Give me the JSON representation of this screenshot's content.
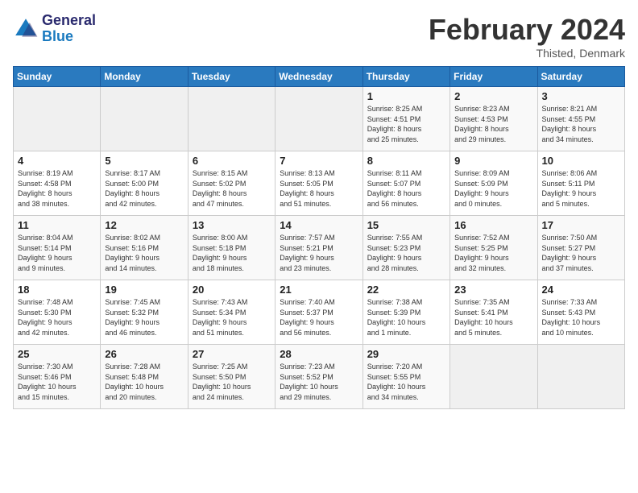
{
  "logo": {
    "line1": "General",
    "line2": "Blue"
  },
  "title": "February 2024",
  "subtitle": "Thisted, Denmark",
  "days_header": [
    "Sunday",
    "Monday",
    "Tuesday",
    "Wednesday",
    "Thursday",
    "Friday",
    "Saturday"
  ],
  "weeks": [
    [
      {
        "day": "",
        "info": ""
      },
      {
        "day": "",
        "info": ""
      },
      {
        "day": "",
        "info": ""
      },
      {
        "day": "",
        "info": ""
      },
      {
        "day": "1",
        "info": "Sunrise: 8:25 AM\nSunset: 4:51 PM\nDaylight: 8 hours\nand 25 minutes."
      },
      {
        "day": "2",
        "info": "Sunrise: 8:23 AM\nSunset: 4:53 PM\nDaylight: 8 hours\nand 29 minutes."
      },
      {
        "day": "3",
        "info": "Sunrise: 8:21 AM\nSunset: 4:55 PM\nDaylight: 8 hours\nand 34 minutes."
      }
    ],
    [
      {
        "day": "4",
        "info": "Sunrise: 8:19 AM\nSunset: 4:58 PM\nDaylight: 8 hours\nand 38 minutes."
      },
      {
        "day": "5",
        "info": "Sunrise: 8:17 AM\nSunset: 5:00 PM\nDaylight: 8 hours\nand 42 minutes."
      },
      {
        "day": "6",
        "info": "Sunrise: 8:15 AM\nSunset: 5:02 PM\nDaylight: 8 hours\nand 47 minutes."
      },
      {
        "day": "7",
        "info": "Sunrise: 8:13 AM\nSunset: 5:05 PM\nDaylight: 8 hours\nand 51 minutes."
      },
      {
        "day": "8",
        "info": "Sunrise: 8:11 AM\nSunset: 5:07 PM\nDaylight: 8 hours\nand 56 minutes."
      },
      {
        "day": "9",
        "info": "Sunrise: 8:09 AM\nSunset: 5:09 PM\nDaylight: 9 hours\nand 0 minutes."
      },
      {
        "day": "10",
        "info": "Sunrise: 8:06 AM\nSunset: 5:11 PM\nDaylight: 9 hours\nand 5 minutes."
      }
    ],
    [
      {
        "day": "11",
        "info": "Sunrise: 8:04 AM\nSunset: 5:14 PM\nDaylight: 9 hours\nand 9 minutes."
      },
      {
        "day": "12",
        "info": "Sunrise: 8:02 AM\nSunset: 5:16 PM\nDaylight: 9 hours\nand 14 minutes."
      },
      {
        "day": "13",
        "info": "Sunrise: 8:00 AM\nSunset: 5:18 PM\nDaylight: 9 hours\nand 18 minutes."
      },
      {
        "day": "14",
        "info": "Sunrise: 7:57 AM\nSunset: 5:21 PM\nDaylight: 9 hours\nand 23 minutes."
      },
      {
        "day": "15",
        "info": "Sunrise: 7:55 AM\nSunset: 5:23 PM\nDaylight: 9 hours\nand 28 minutes."
      },
      {
        "day": "16",
        "info": "Sunrise: 7:52 AM\nSunset: 5:25 PM\nDaylight: 9 hours\nand 32 minutes."
      },
      {
        "day": "17",
        "info": "Sunrise: 7:50 AM\nSunset: 5:27 PM\nDaylight: 9 hours\nand 37 minutes."
      }
    ],
    [
      {
        "day": "18",
        "info": "Sunrise: 7:48 AM\nSunset: 5:30 PM\nDaylight: 9 hours\nand 42 minutes."
      },
      {
        "day": "19",
        "info": "Sunrise: 7:45 AM\nSunset: 5:32 PM\nDaylight: 9 hours\nand 46 minutes."
      },
      {
        "day": "20",
        "info": "Sunrise: 7:43 AM\nSunset: 5:34 PM\nDaylight: 9 hours\nand 51 minutes."
      },
      {
        "day": "21",
        "info": "Sunrise: 7:40 AM\nSunset: 5:37 PM\nDaylight: 9 hours\nand 56 minutes."
      },
      {
        "day": "22",
        "info": "Sunrise: 7:38 AM\nSunset: 5:39 PM\nDaylight: 10 hours\nand 1 minute."
      },
      {
        "day": "23",
        "info": "Sunrise: 7:35 AM\nSunset: 5:41 PM\nDaylight: 10 hours\nand 5 minutes."
      },
      {
        "day": "24",
        "info": "Sunrise: 7:33 AM\nSunset: 5:43 PM\nDaylight: 10 hours\nand 10 minutes."
      }
    ],
    [
      {
        "day": "25",
        "info": "Sunrise: 7:30 AM\nSunset: 5:46 PM\nDaylight: 10 hours\nand 15 minutes."
      },
      {
        "day": "26",
        "info": "Sunrise: 7:28 AM\nSunset: 5:48 PM\nDaylight: 10 hours\nand 20 minutes."
      },
      {
        "day": "27",
        "info": "Sunrise: 7:25 AM\nSunset: 5:50 PM\nDaylight: 10 hours\nand 24 minutes."
      },
      {
        "day": "28",
        "info": "Sunrise: 7:23 AM\nSunset: 5:52 PM\nDaylight: 10 hours\nand 29 minutes."
      },
      {
        "day": "29",
        "info": "Sunrise: 7:20 AM\nSunset: 5:55 PM\nDaylight: 10 hours\nand 34 minutes."
      },
      {
        "day": "",
        "info": ""
      },
      {
        "day": "",
        "info": ""
      }
    ]
  ]
}
